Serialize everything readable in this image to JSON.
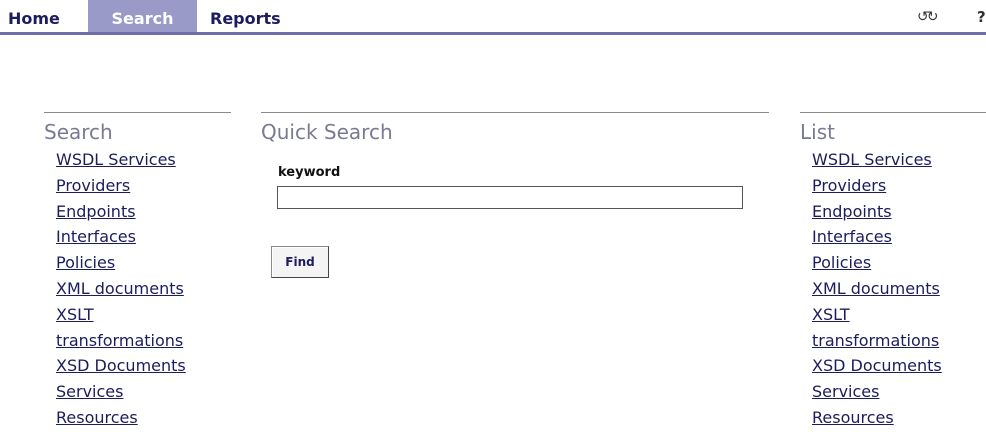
{
  "nav": {
    "tabs": [
      {
        "label": "Home"
      },
      {
        "label": "Search",
        "active": true
      },
      {
        "label": "Reports"
      }
    ],
    "refresh_icon_glyph": "↺↻",
    "help_icon_glyph": "?"
  },
  "search_column": {
    "title": "Search",
    "links": [
      "WSDL Services",
      "Providers",
      "Endpoints",
      "Interfaces",
      "Policies",
      "XML documents",
      "XSLT",
      "transformations",
      "XSD Documents",
      "Services",
      "Resources"
    ]
  },
  "quick_search": {
    "title": "Quick Search",
    "keyword_label": "keyword",
    "keyword_value": "",
    "find_label": "Find"
  },
  "list_column": {
    "title": "List",
    "links": [
      "WSDL Services",
      "Providers",
      "Endpoints",
      "Interfaces",
      "Policies",
      "XML documents",
      "XSLT",
      "transformations",
      "XSD Documents",
      "Services",
      "Resources"
    ]
  },
  "colors": {
    "accent": "#9a9ac8",
    "nav_rule": "#6e6ea8",
    "link": "#1c1c5e",
    "section_title": "#7a7a94"
  }
}
